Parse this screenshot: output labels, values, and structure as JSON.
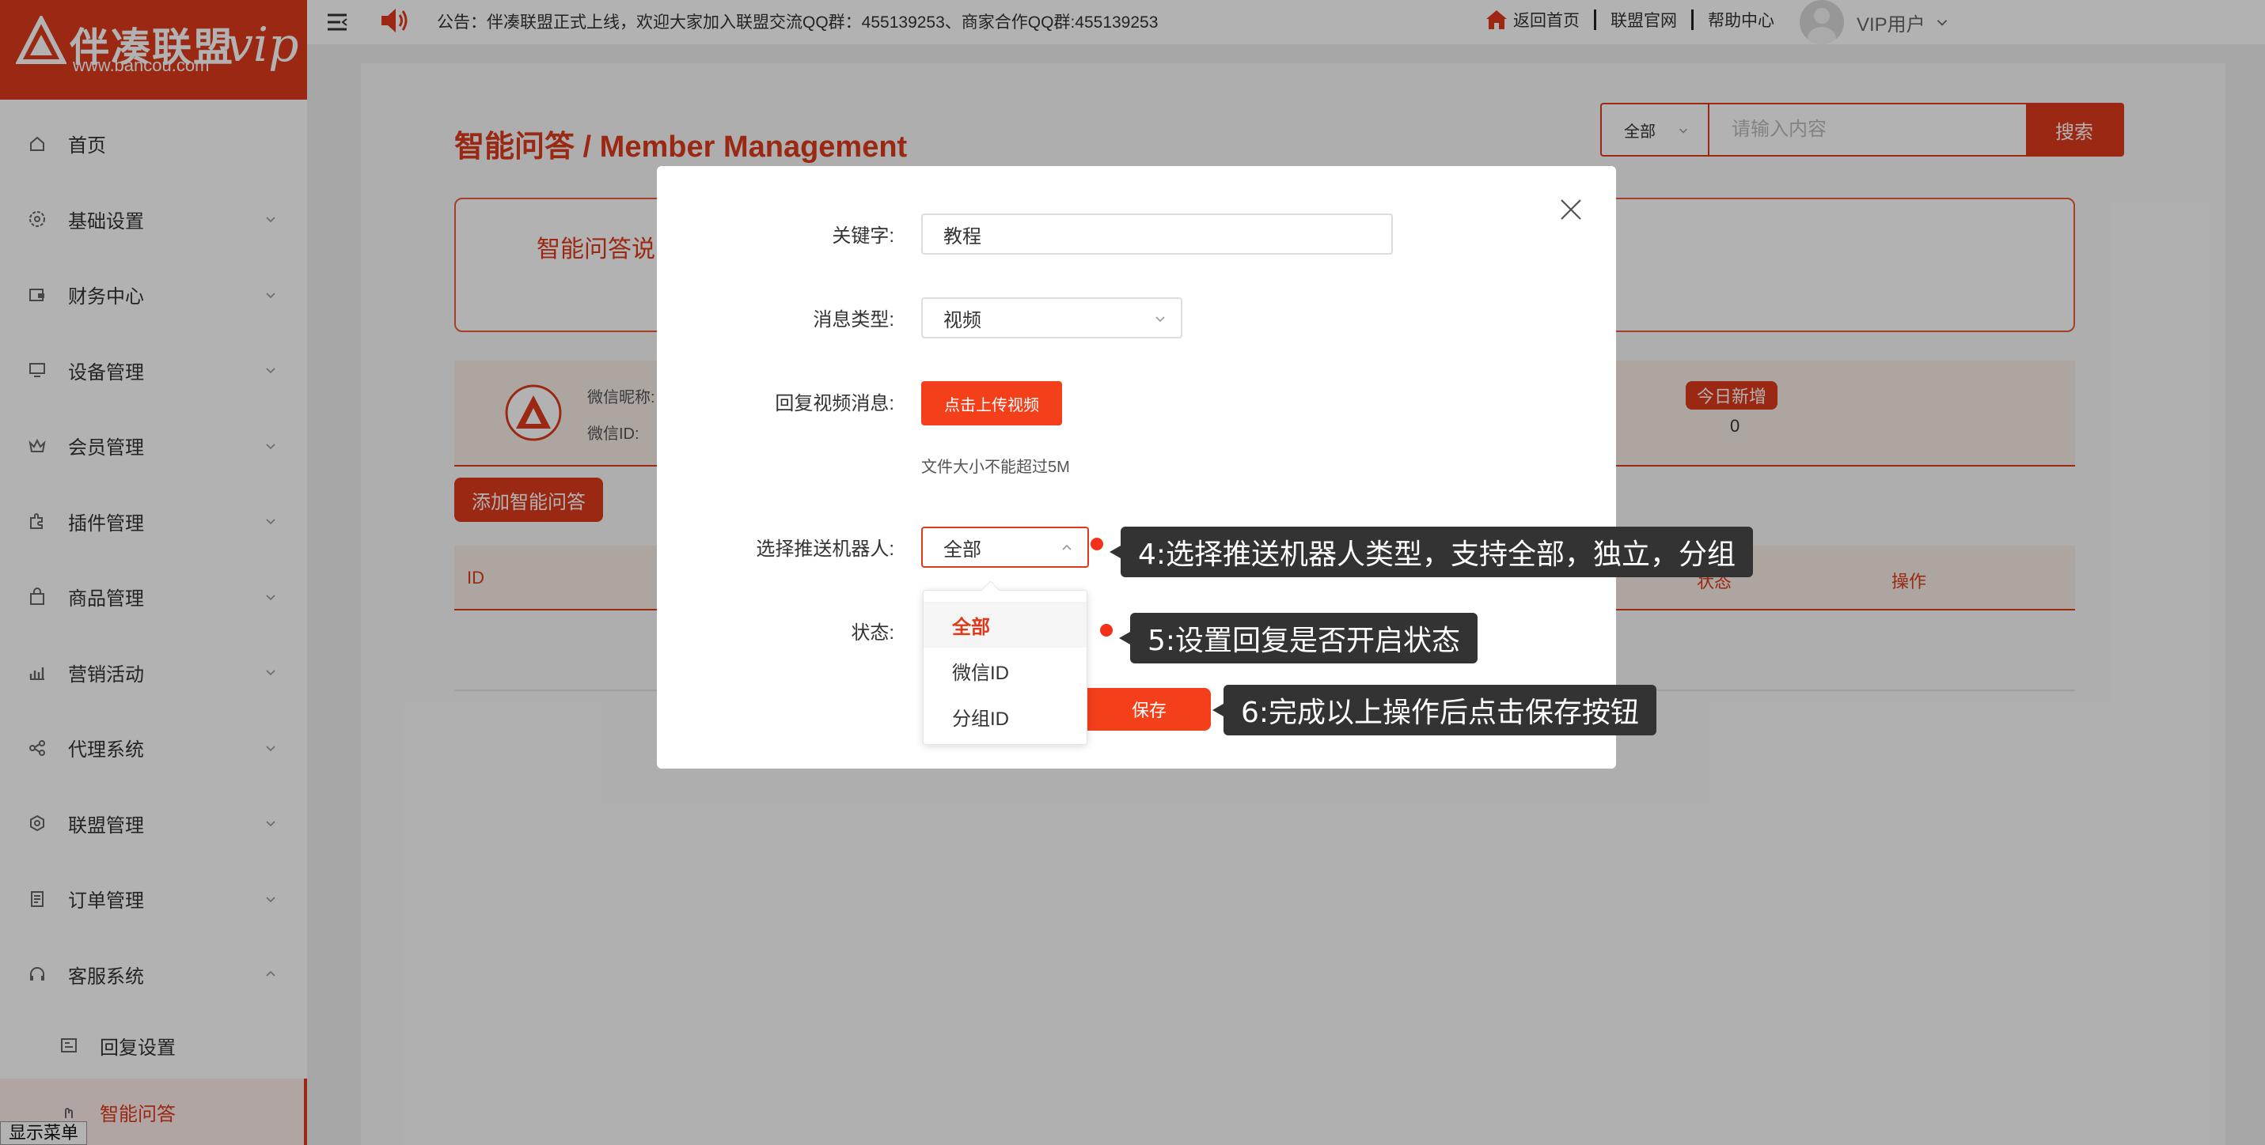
{
  "brand": {
    "name": "伴凑联盟",
    "url": "www.bancou.com",
    "vip": "vip"
  },
  "topbar": {
    "notice": "公告：伴凑联盟正式上线，欢迎大家加入联盟交流QQ群：455139253、商家合作QQ群:455139253",
    "links": [
      "返回首页",
      "联盟官网",
      "帮助中心"
    ],
    "user": "VIP用户"
  },
  "sidebar": {
    "items": [
      {
        "label": "首页",
        "icon": "home-icon"
      },
      {
        "label": "基础设置",
        "icon": "settings-icon"
      },
      {
        "label": "财务中心",
        "icon": "finance-icon"
      },
      {
        "label": "设备管理",
        "icon": "monitor-icon"
      },
      {
        "label": "会员管理",
        "icon": "crown-icon"
      },
      {
        "label": "插件管理",
        "icon": "plugin-icon"
      },
      {
        "label": "商品管理",
        "icon": "bag-icon"
      },
      {
        "label": "营销活动",
        "icon": "chart-icon"
      },
      {
        "label": "代理系统",
        "icon": "share-icon"
      },
      {
        "label": "联盟管理",
        "icon": "hex-icon"
      },
      {
        "label": "订单管理",
        "icon": "order-icon"
      },
      {
        "label": "客服系统",
        "icon": "headset-icon"
      }
    ],
    "sub_items": [
      {
        "label": "回复设置",
        "icon": "reply-icon"
      },
      {
        "label": "智能问答",
        "icon": "qa-icon"
      }
    ],
    "show_menu": "显示菜单"
  },
  "main": {
    "title": "智能问答 / Member Management",
    "search": {
      "scope": "全部",
      "placeholder": "请输入内容",
      "button": "搜索"
    },
    "info_title": "智能问答说明",
    "stats": {
      "label1": "微信昵称:",
      "label2": "微信ID:",
      "today_label": "今日新增",
      "today_value": "0"
    },
    "add_button": "添加智能问答",
    "table": {
      "col_id": "ID",
      "col_status": "状态",
      "col_ops": "操作"
    }
  },
  "modal": {
    "keyword_label": "关键字:",
    "keyword_value": "教程",
    "msgtype_label": "消息类型:",
    "msgtype_value": "视频",
    "reply_label": "回复视频消息:",
    "upload_button": "点击上传视频",
    "file_hint": "文件大小不能超过5M",
    "robot_label": "选择推送机器人:",
    "robot_value": "全部",
    "robot_options": [
      "全部",
      "微信ID",
      "分组ID"
    ],
    "status_label": "状态:",
    "save_button": "保存"
  },
  "annotations": [
    "4:选择推送机器人类型，支持全部，独立，分组",
    "5:设置回复是否开启状态",
    "6:完成以上操作后点击保存按钮"
  ],
  "colors": {
    "brand": "#dd3a1b",
    "button": "#f43f1b",
    "tooltip": "#333333"
  }
}
